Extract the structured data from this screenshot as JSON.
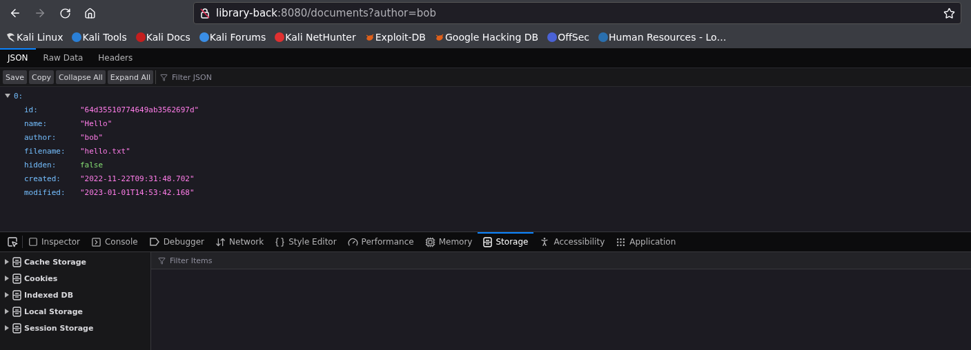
{
  "browser": {
    "back_disabled": false,
    "forward_disabled": true,
    "url": {
      "host": "library-back",
      "rest": ":8080/documents?author=bob"
    }
  },
  "bookmarks": [
    "Kali Linux",
    "Kali Tools",
    "Kali Docs",
    "Kali Forums",
    "Kali NetHunter",
    "Exploit-DB",
    "Google Hacking DB",
    "OffSec",
    "Human Resources - Lo…"
  ],
  "viewer": {
    "tabs": [
      {
        "label": "JSON",
        "selected": true
      },
      {
        "label": "Raw Data",
        "selected": false
      },
      {
        "label": "Headers",
        "selected": false
      }
    ],
    "buttons": [
      "Save",
      "Copy",
      "Collapse All",
      "Expand All"
    ],
    "filter": {
      "placeholder": "Filter JSON"
    },
    "tree": [
      {
        "key": "0:",
        "expanded": true,
        "children": [
          {
            "key": "id:",
            "kind": "string",
            "value": "\"64d35510774649ab3562697d\""
          },
          {
            "key": "name:",
            "kind": "string",
            "value": "\"Hello\""
          },
          {
            "key": "author:",
            "kind": "string",
            "value": "\"bob\""
          },
          {
            "key": "filename:",
            "kind": "string",
            "value": "\"hello.txt\""
          },
          {
            "key": "hidden:",
            "kind": "boolean",
            "value": "false"
          },
          {
            "key": "created:",
            "kind": "string",
            "value": "\"2022-11-22T09:31:48.702\""
          },
          {
            "key": "modified:",
            "kind": "string",
            "value": "\"2023-01-01T14:53:42.168\""
          }
        ]
      }
    ]
  },
  "devtools": {
    "tabs": [
      {
        "label": "Inspector",
        "selected": false
      },
      {
        "label": "Console",
        "selected": false
      },
      {
        "label": "Debugger",
        "selected": false
      },
      {
        "label": "Network",
        "selected": false
      },
      {
        "label": "Style Editor",
        "selected": false
      },
      {
        "label": "Performance",
        "selected": false
      },
      {
        "label": "Memory",
        "selected": false
      },
      {
        "label": "Storage",
        "selected": true
      },
      {
        "label": "Accessibility",
        "selected": false
      },
      {
        "label": "Application",
        "selected": false
      }
    ],
    "storage_tree": [
      {
        "label": "Cache Storage",
        "expanded": false
      },
      {
        "label": "Cookies",
        "expanded": false
      },
      {
        "label": "Indexed DB",
        "expanded": false
      },
      {
        "label": "Local Storage",
        "expanded": false
      },
      {
        "label": "Session Storage",
        "expanded": false
      }
    ],
    "filter": {
      "placeholder": "Filter Items"
    }
  }
}
